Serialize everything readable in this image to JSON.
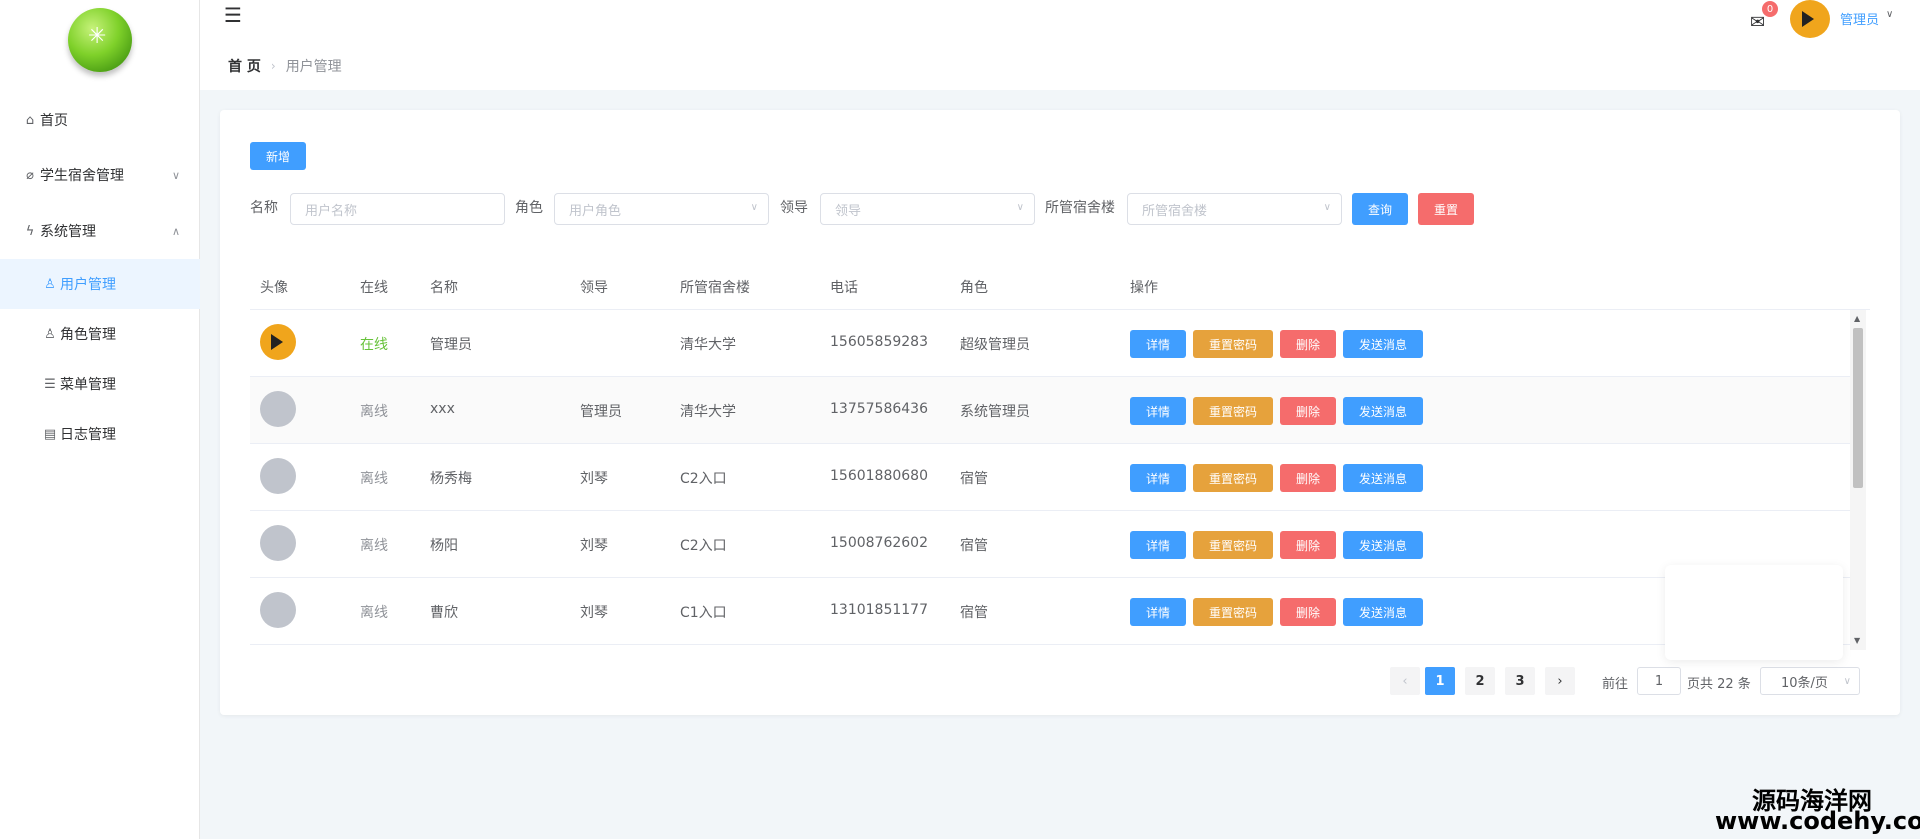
{
  "header": {
    "breadcrumb_home": "首 页",
    "breadcrumb_current": "用户管理",
    "mail_badge": "0",
    "user_name": "管理员"
  },
  "sidebar": {
    "items": [
      {
        "label": "首页",
        "icon": "home-icon"
      },
      {
        "label": "学生宿舍管理",
        "icon": "paperclip-icon"
      },
      {
        "label": "系统管理",
        "icon": "lightning-icon"
      },
      {
        "label": "用户管理",
        "icon": "user-icon"
      },
      {
        "label": "角色管理",
        "icon": "user-group-icon"
      },
      {
        "label": "菜单管理",
        "icon": "list-icon"
      },
      {
        "label": "日志管理",
        "icon": "table-icon"
      }
    ]
  },
  "toolbar": {
    "add_label": "新增",
    "search_label": "查询",
    "reset_label": "重置"
  },
  "filters": {
    "name_label": "名称",
    "name_placeholder": "用户名称",
    "role_label": "角色",
    "role_placeholder": "用户角色",
    "leader_label": "领导",
    "leader_placeholder": "领导",
    "dorm_label": "所管宿舍楼",
    "dorm_placeholder": "所管宿舍楼"
  },
  "table": {
    "columns": [
      "头像",
      "在线",
      "名称",
      "领导",
      "所管宿舍楼",
      "电话",
      "角色",
      "操作"
    ],
    "actions": {
      "detail": "详情",
      "reset_password": "重置密码",
      "delete": "删除",
      "send_message": "发送消息"
    },
    "rows": [
      {
        "online": "在线",
        "name": "管理员",
        "leader": "",
        "dorm": "清华大学",
        "phone": "15605859283",
        "role": "超级管理员"
      },
      {
        "online": "离线",
        "name": "xxx",
        "leader": "管理员",
        "dorm": "清华大学",
        "phone": "13757586436",
        "role": "系统管理员"
      },
      {
        "online": "离线",
        "name": "杨秀梅",
        "leader": "刘琴",
        "dorm": "C2入口",
        "phone": "15601880680",
        "role": "宿管"
      },
      {
        "online": "离线",
        "name": "杨阳",
        "leader": "刘琴",
        "dorm": "C2入口",
        "phone": "15008762602",
        "role": "宿管"
      },
      {
        "online": "离线",
        "name": "曹欣",
        "leader": "刘琴",
        "dorm": "C1入口",
        "phone": "13101851177",
        "role": "宿管"
      }
    ]
  },
  "pagination": {
    "pages": [
      "1",
      "2",
      "3"
    ],
    "current_page": "1",
    "goto_label": "前往",
    "goto_value": "1",
    "total_label": "页共 22 条",
    "page_size": "10条/页"
  },
  "watermark": {
    "line1": "源码海洋网",
    "line2": "www.codehy.com"
  }
}
